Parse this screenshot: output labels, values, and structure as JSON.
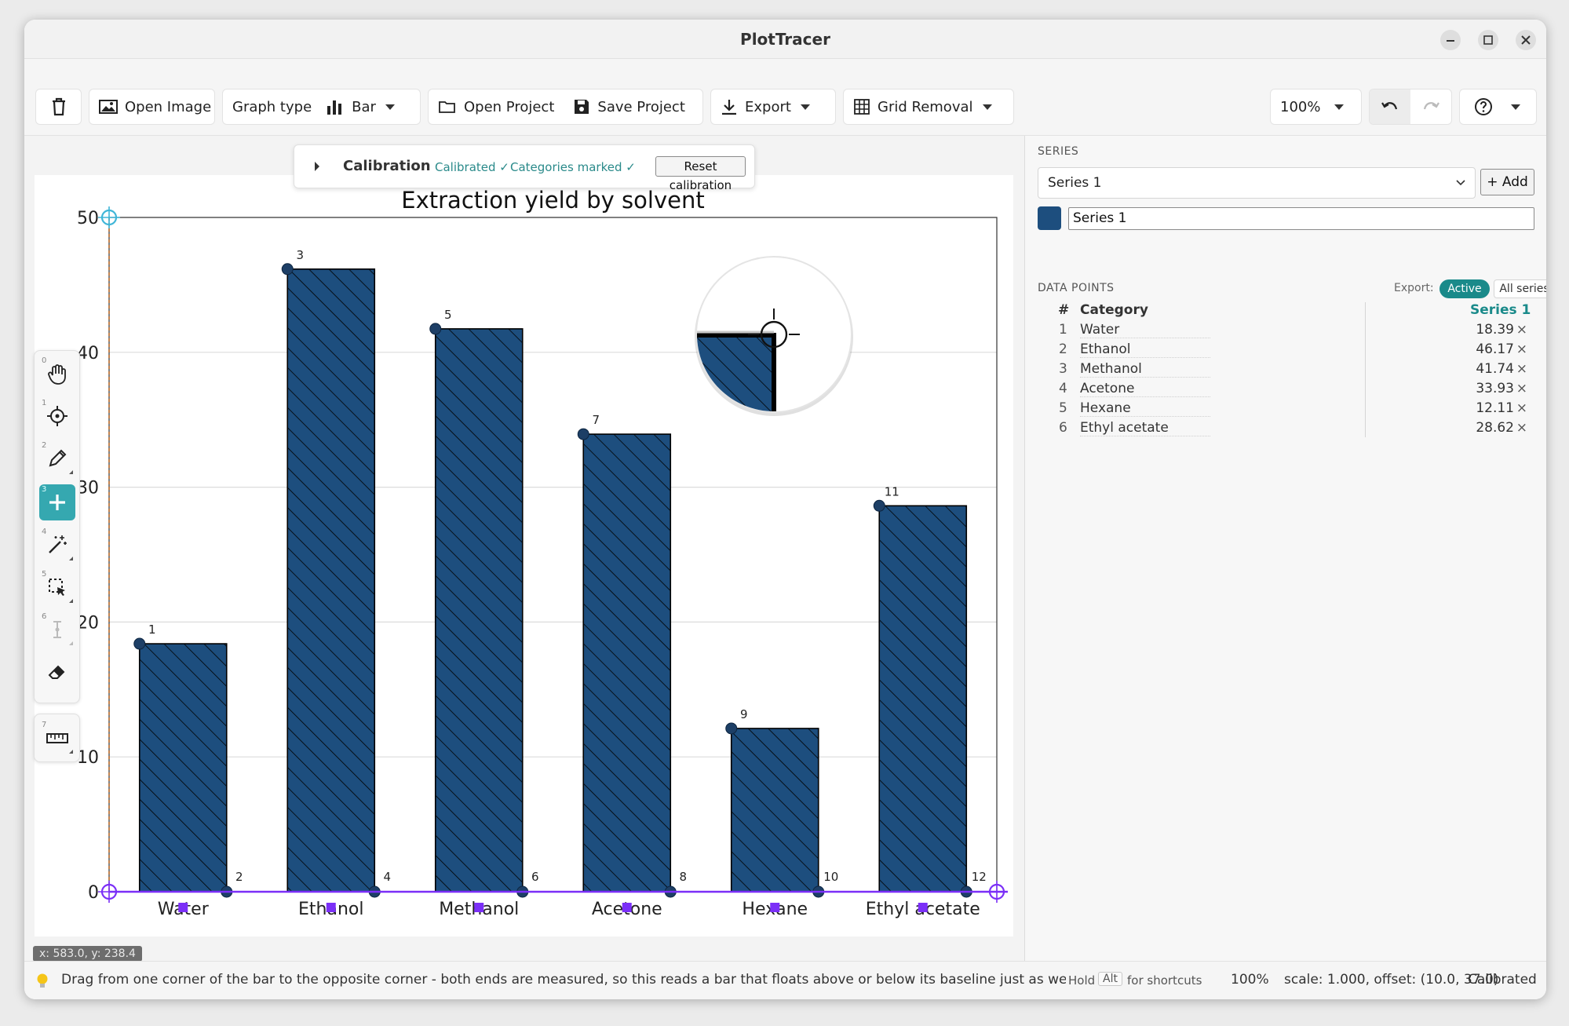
{
  "window": {
    "title": "PlotTracer"
  },
  "toolbar": {
    "open_image": "Open Image",
    "graph_type_label": "Graph type",
    "graph_type_value": "Bar",
    "open_project": "Open Project",
    "save_project": "Save Project",
    "export": "Export",
    "grid_removal": "Grid Removal",
    "zoom": "100%"
  },
  "calibration": {
    "title": "Calibration",
    "calibrated": "Calibrated ✓",
    "categories_marked": "Categories marked ✓",
    "reset": "Reset calibration"
  },
  "tools": [
    {
      "num": "0",
      "icon": "hand-icon"
    },
    {
      "num": "1",
      "icon": "crosshair-icon"
    },
    {
      "num": "2",
      "icon": "pencil-icon"
    },
    {
      "num": "3",
      "icon": "plus-icon"
    },
    {
      "num": "4",
      "icon": "magic-wand-icon"
    },
    {
      "num": "5",
      "icon": "box-select-icon"
    },
    {
      "num": "6",
      "icon": "error-bar-icon"
    },
    {
      "num": "",
      "icon": "eraser-icon"
    },
    {
      "num": "7",
      "icon": "ruler-icon"
    }
  ],
  "coord_readout": "x: 583.0, y: 238.4",
  "chart_data": {
    "type": "bar",
    "title": "Extraction yield by solvent",
    "xlabel": "",
    "ylabel": "",
    "categories": [
      "Water",
      "Ethanol",
      "Methanol",
      "Acetone",
      "Hexane",
      "Ethyl acetate"
    ],
    "values": [
      18.39,
      46.17,
      41.74,
      33.93,
      12.11,
      28.62
    ],
    "ylim": [
      0,
      50
    ],
    "yticks": [
      "0",
      "10",
      "20",
      "30",
      "40",
      "50"
    ],
    "grid": true,
    "bar_color": "#1d4e7e",
    "hatch": "diagonal",
    "point_labels": [
      "1",
      "2",
      "3",
      "4",
      "5",
      "6",
      "7",
      "8",
      "9",
      "10",
      "11",
      "12"
    ]
  },
  "panel": {
    "series_heading": "SERIES",
    "series_select": "Series 1",
    "add_button": "+ Add",
    "series_name": "Series 1",
    "series_color": "#1d4e7e",
    "data_points_heading": "DATA POINTS",
    "export_label": "Export:",
    "export_active": "Active",
    "export_all": "All series",
    "col_num": "#",
    "col_category": "Category",
    "col_series": "Series 1",
    "rows": [
      {
        "num": "1",
        "category": "Water",
        "value": "18.39"
      },
      {
        "num": "2",
        "category": "Ethanol",
        "value": "46.17"
      },
      {
        "num": "3",
        "category": "Methanol",
        "value": "41.74"
      },
      {
        "num": "4",
        "category": "Acetone",
        "value": "33.93"
      },
      {
        "num": "5",
        "category": "Hexane",
        "value": "12.11"
      },
      {
        "num": "6",
        "category": "Ethyl acetate",
        "value": "28.62"
      }
    ],
    "delete_glyph": "×"
  },
  "status": {
    "hint": "Drag from one corner of the bar to the opposite corner - both ends are measured, so this reads a bar that floats above or below its baseline just as well as…",
    "hold": "Hold",
    "alt_key": "Alt",
    "for_shortcuts": "for shortcuts",
    "zoom": "100%",
    "scale_offset": "scale: 1.000, offset: (10.0, 37.0)",
    "state": "Calibrated"
  },
  "colors": {
    "accent": "#1a8a8a",
    "calib_text": "#2a8a8a",
    "axis_purple": "#7b2ff7",
    "handle_cyan": "#3fb6d8"
  }
}
